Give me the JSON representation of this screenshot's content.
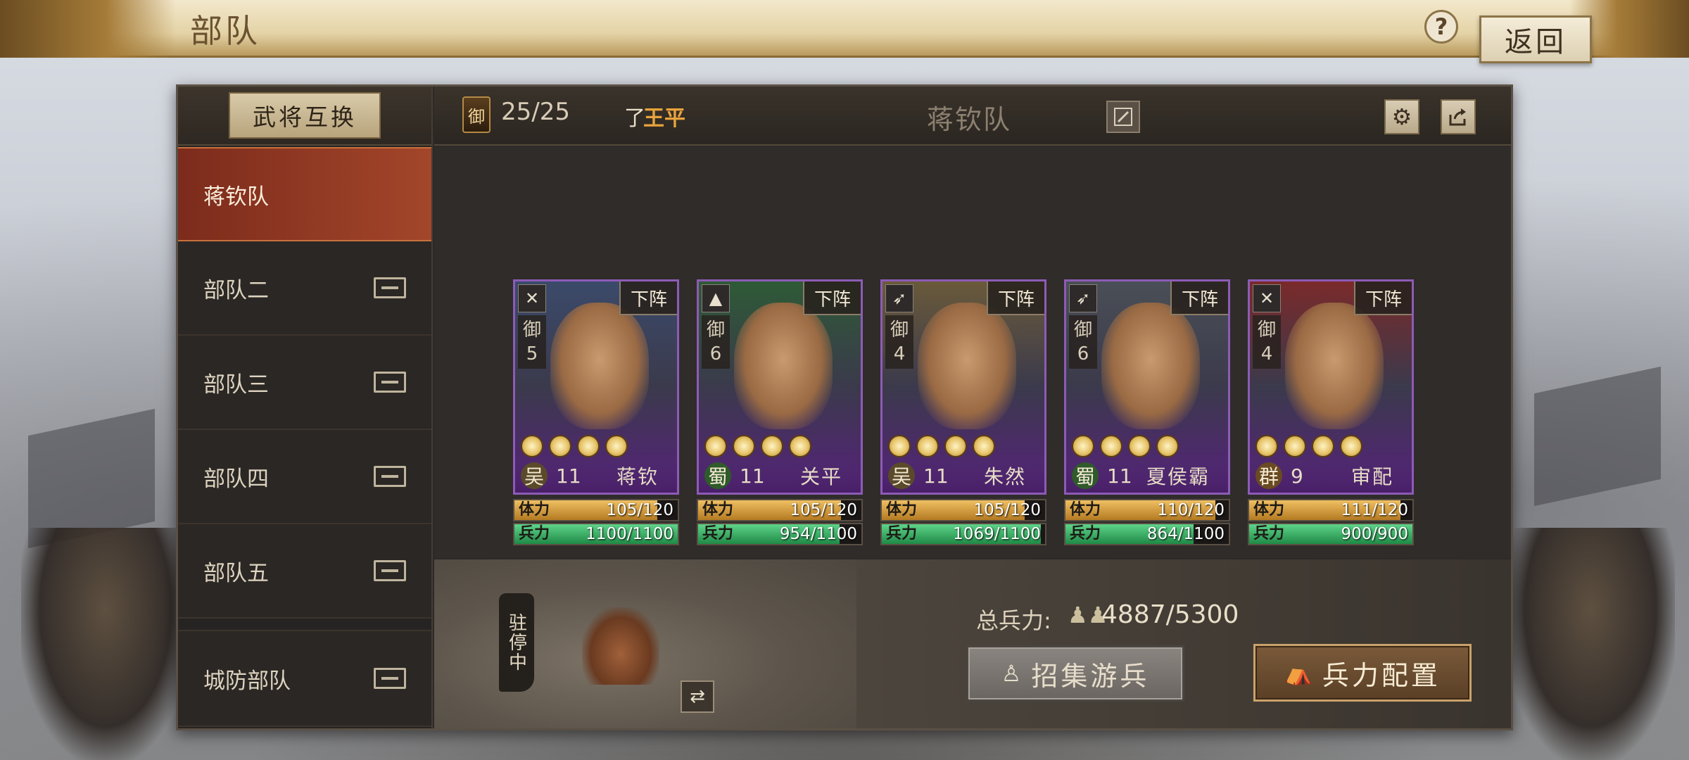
{
  "header": {
    "title": "部队",
    "help_label": "?",
    "back_label": "返回"
  },
  "sidebar": {
    "swap_label": "武将互换",
    "items": [
      {
        "label": "蒋钦队",
        "active": true
      },
      {
        "label": "部队二"
      },
      {
        "label": "部队三"
      },
      {
        "label": "部队四"
      },
      {
        "label": "部队五"
      },
      {
        "label": "城防部队"
      }
    ]
  },
  "team": {
    "command_badge": "御",
    "command_value": "25/25",
    "leader_mark": "了",
    "leader_name": "王平",
    "name": "蒋钦队",
    "icons": {
      "edit": "edit-icon",
      "settings": "gear-icon",
      "share": "share-icon"
    }
  },
  "cards": [
    {
      "type_icon": "bow-icon",
      "type_glyph": "✕",
      "defense_label": "御",
      "defense": "5",
      "down_label": "下阵",
      "faction": "吴",
      "faction_color": "#5a4a2a",
      "level": "11",
      "name": "蒋钦",
      "hp_label": "体力",
      "hp": "105/120",
      "hp_ratio": 0.875,
      "troop_label": "兵力",
      "troop": "1100/1100",
      "troop_ratio": 1.0,
      "tint": "#3b4a6a"
    },
    {
      "type_icon": "cavalry-icon",
      "type_glyph": "▲",
      "defense_label": "御",
      "defense": "6",
      "down_label": "下阵",
      "faction": "蜀",
      "faction_color": "#2f5a2a",
      "level": "11",
      "name": "关平",
      "hp_label": "体力",
      "hp": "105/120",
      "hp_ratio": 0.875,
      "troop_label": "兵力",
      "troop": "954/1100",
      "troop_ratio": 0.867,
      "tint": "#2e5a36"
    },
    {
      "type_icon": "spear-icon",
      "type_glyph": "➶",
      "defense_label": "御",
      "defense": "4",
      "down_label": "下阵",
      "faction": "吴",
      "faction_color": "#5a4a2a",
      "level": "11",
      "name": "朱然",
      "hp_label": "体力",
      "hp": "105/120",
      "hp_ratio": 0.875,
      "troop_label": "兵力",
      "troop": "1069/1100",
      "troop_ratio": 0.972,
      "tint": "#6a5a3a"
    },
    {
      "type_icon": "spear-icon",
      "type_glyph": "➶",
      "defense_label": "御",
      "defense": "6",
      "down_label": "下阵",
      "faction": "蜀",
      "faction_color": "#2f5a2a",
      "level": "11",
      "name": "夏侯霸",
      "hp_label": "体力",
      "hp": "110/120",
      "hp_ratio": 0.917,
      "troop_label": "兵力",
      "troop": "864/1100",
      "troop_ratio": 0.785,
      "tint": "#4a4f56"
    },
    {
      "type_icon": "bow-icon",
      "type_glyph": "✕",
      "defense_label": "御",
      "defense": "4",
      "down_label": "下阵",
      "faction": "群",
      "faction_color": "#6a4a22",
      "level": "9",
      "name": "审配",
      "hp_label": "体力",
      "hp": "111/120",
      "hp_ratio": 0.925,
      "troop_label": "兵力",
      "troop": "900/900",
      "troop_ratio": 1.0,
      "tint": "#7a2a2a"
    }
  ],
  "bottom": {
    "status": "驻停中",
    "total_label": "总兵力:",
    "total_value": "4887/5300",
    "recruit_label": "招集游兵",
    "config_label": "兵力配置"
  }
}
